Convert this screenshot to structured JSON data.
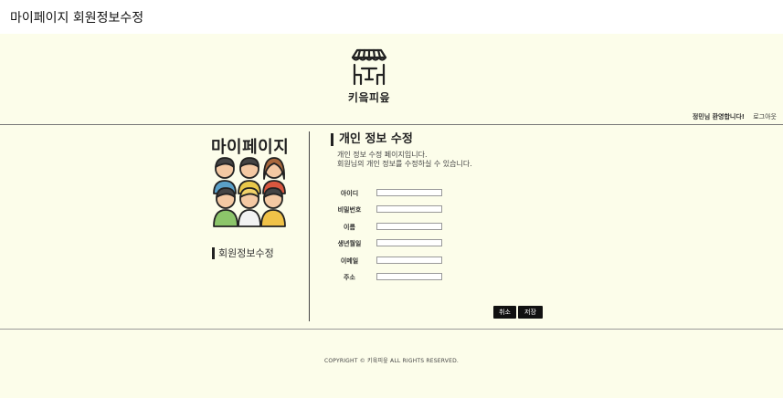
{
  "page": {
    "title": "마이페이지 회원정보수정"
  },
  "header": {
    "brand": "키읔피읖",
    "welcome": "정민님 환영합니다!",
    "logout": "로그아웃"
  },
  "sidebar": {
    "title": "마이페이지",
    "menu_item": "회원정보수정"
  },
  "main": {
    "section_title": "개인 정보 수정",
    "desc_line1": "개인 정보 수정 페이지입니다.",
    "desc_line2": "회원님의 개인 정보를 수정하실 수 있습니다."
  },
  "form": {
    "fields": [
      {
        "label": "아이디",
        "value": ""
      },
      {
        "label": "비밀번호",
        "value": ""
      },
      {
        "label": "이름",
        "value": ""
      },
      {
        "label": "생년월일",
        "value": ""
      },
      {
        "label": "이메일",
        "value": ""
      },
      {
        "label": "주소",
        "value": ""
      }
    ],
    "cancel_label": "취소",
    "save_label": "저장"
  },
  "footer": {
    "copyright": "COPYRIGHT © 키읔피읖 ALL RIGHTS RESERVED."
  },
  "colors": {
    "background": "#fcfdea",
    "button": "#111111"
  },
  "icons": {
    "logo": "market-stall-icon",
    "sidebar": "people-group-icon"
  }
}
